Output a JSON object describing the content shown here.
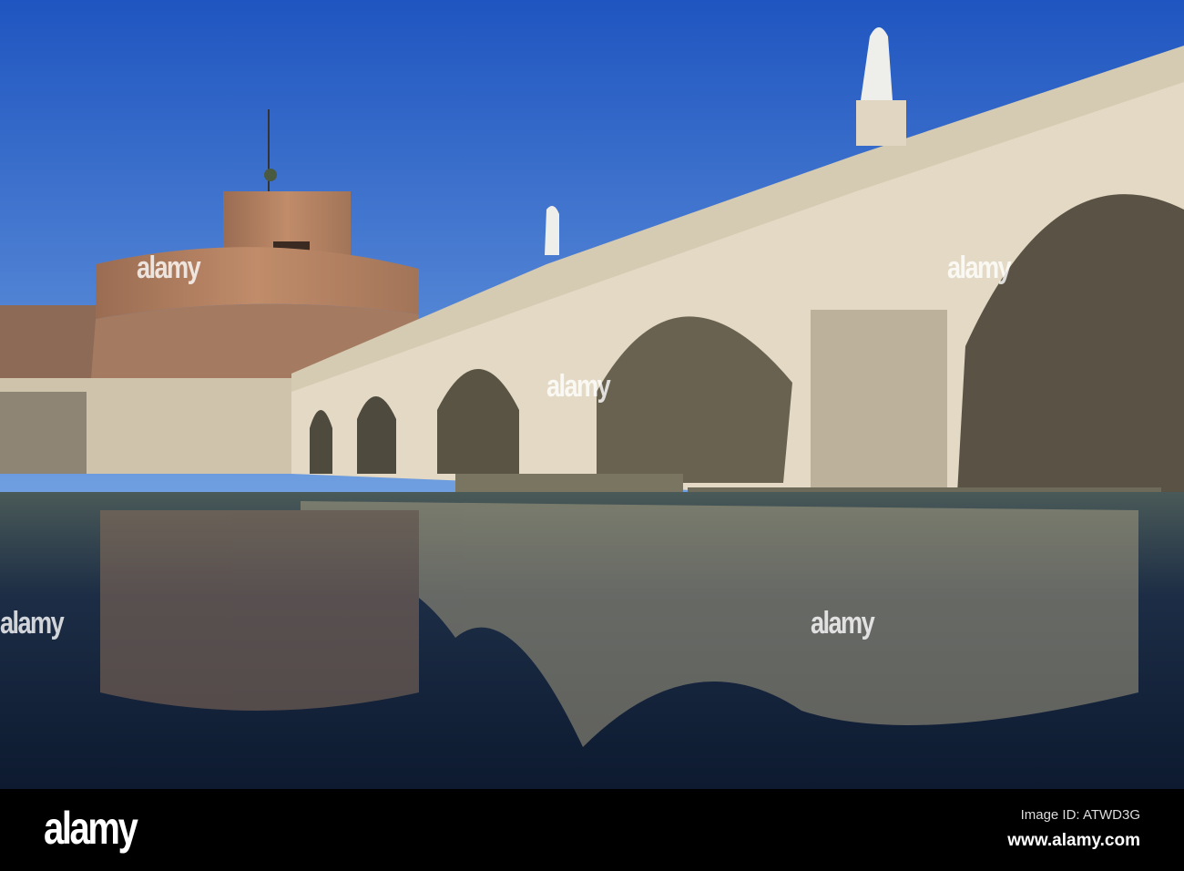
{
  "photo": {
    "subject": "Castel Sant'Angelo and Ponte Sant'Angelo over the Tiber",
    "colors": {
      "sky_top": "#1f55c0",
      "sky_bottom": "#6f9fe0",
      "stone": "#e6dcc8",
      "brick": "#b4805e",
      "water": "#15263f"
    }
  },
  "watermark": {
    "text": "alamy"
  },
  "footer": {
    "logo": "alamy",
    "image_id": "Image ID: ATWD3G",
    "website": "www.alamy.com"
  }
}
